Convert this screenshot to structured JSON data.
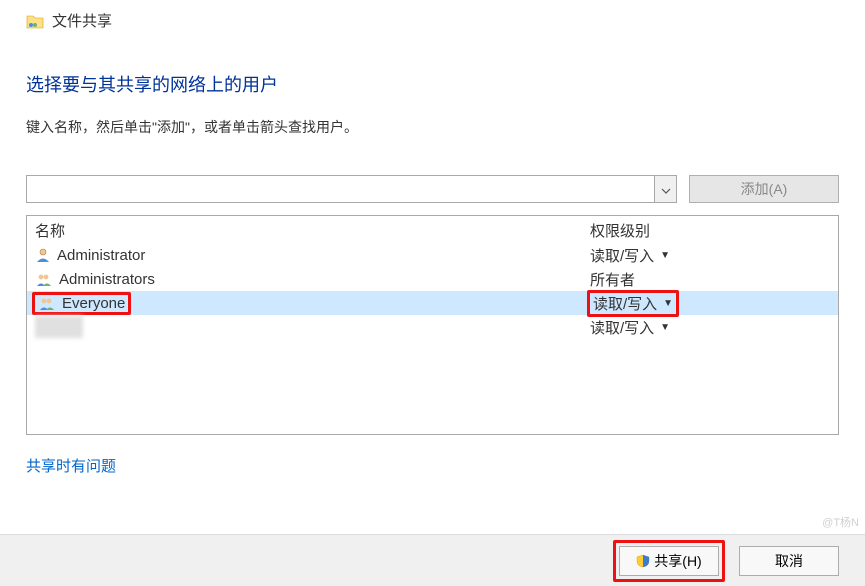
{
  "window": {
    "title": "文件共享"
  },
  "heading": "选择要与其共享的网络上的用户",
  "instruction": "键入名称，然后单击\"添加\"，或者单击箭头查找用户。",
  "combo": {
    "value": ""
  },
  "buttons": {
    "add": "添加(A)",
    "share": "共享(H)",
    "cancel": "取消"
  },
  "columns": {
    "name": "名称",
    "permission": "权限级别"
  },
  "rows": [
    {
      "name": "Administrator",
      "icon": "user",
      "permission": "读取/写入",
      "caret": true,
      "selected": false,
      "highlight": false
    },
    {
      "name": "Administrators",
      "icon": "group",
      "permission": "所有者",
      "caret": false,
      "selected": false,
      "highlight": false
    },
    {
      "name": "Everyone",
      "icon": "group",
      "permission": "读取/写入",
      "caret": true,
      "selected": true,
      "highlight": true
    },
    {
      "name": "",
      "icon": "blur",
      "permission": "读取/写入",
      "caret": true,
      "selected": false,
      "highlight": false
    }
  ],
  "help_link": "共享时有问题",
  "watermark": "@T杨N"
}
